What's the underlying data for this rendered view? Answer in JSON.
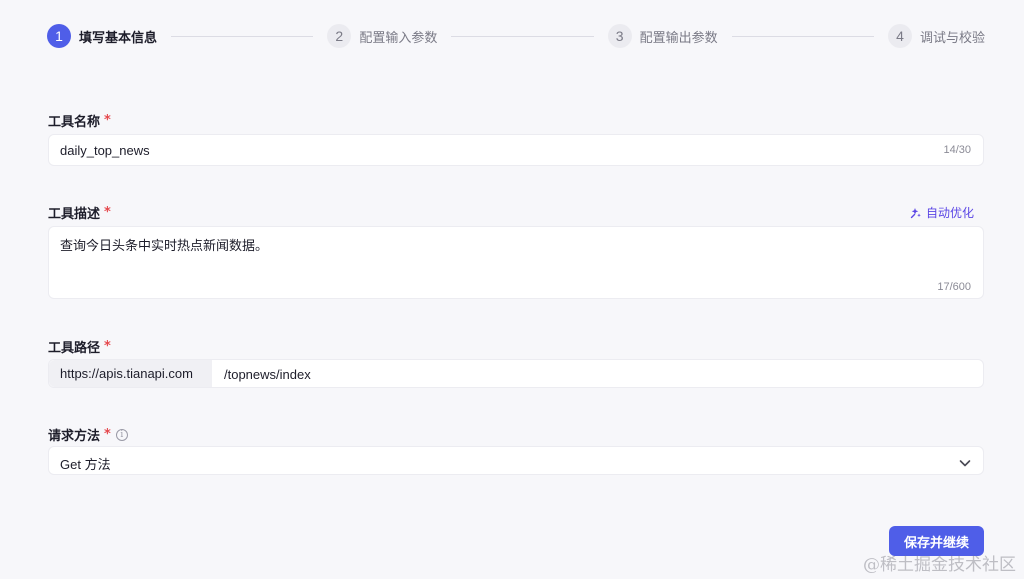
{
  "stepper": {
    "steps": [
      {
        "number": "1",
        "label": "填写基本信息"
      },
      {
        "number": "2",
        "label": "配置输入参数"
      },
      {
        "number": "3",
        "label": "配置输出参数"
      },
      {
        "number": "4",
        "label": "调试与校验"
      }
    ],
    "active_step": 1
  },
  "form": {
    "name": {
      "label": "工具名称",
      "required_mark": "*",
      "value": "daily_top_news",
      "counter": "14/30"
    },
    "description": {
      "label": "工具描述",
      "required_mark": "*",
      "optimize_label": "自动优化",
      "value": "查询今日头条中实时热点新闻数据。",
      "counter": "17/600"
    },
    "path": {
      "label": "工具路径",
      "required_mark": "*",
      "prefix": "https://apis.tianapi.com",
      "value": "/topnews/index"
    },
    "method": {
      "label": "请求方法",
      "required_mark": "*",
      "info_icon": "info-icon",
      "value": "Get 方法"
    }
  },
  "actions": {
    "save_continue": "保存并继续"
  },
  "watermark": "@稀土掘金技术社区",
  "colors": {
    "accent": "#4f5ee8",
    "required": "#e5484d",
    "optimize": "#5b46e5",
    "background": "#f7f7fa"
  }
}
